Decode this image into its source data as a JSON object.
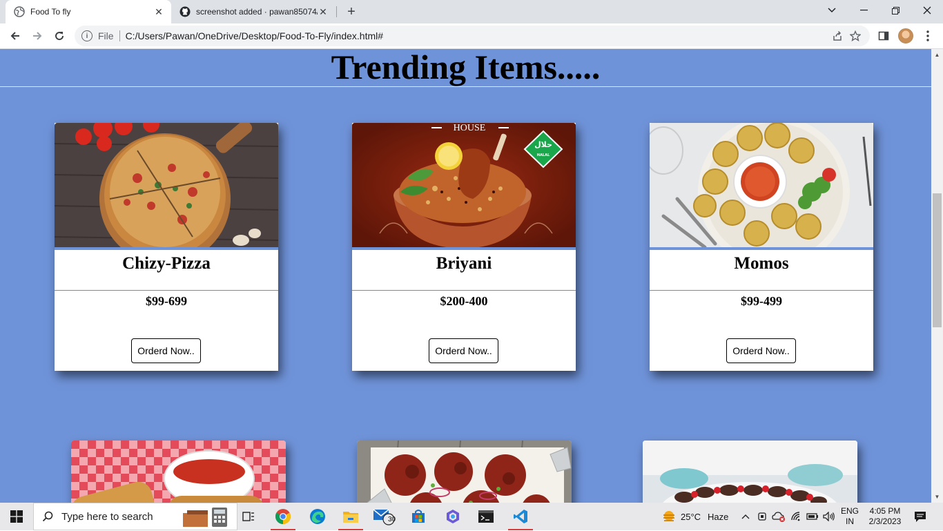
{
  "browser": {
    "tabs": [
      {
        "title": "Food To fly",
        "active": true
      },
      {
        "title": "screenshot added · pawan85074/",
        "active": false
      }
    ],
    "address": {
      "scheme": "File",
      "url": "C:/Users/Pawan/OneDrive/Desktop/Food-To-Fly/index.html#"
    }
  },
  "page": {
    "heading": "Trending Items.....",
    "background_color": "#6f93d9",
    "cards": [
      {
        "name": "Chizy-Pizza",
        "price": "$99-699",
        "button": "Orderd Now.."
      },
      {
        "name": "Briyani",
        "price": "$200-400",
        "button": "Orderd Now.."
      },
      {
        "name": "Momos",
        "price": "$99-499",
        "button": "Orderd Now.."
      }
    ],
    "brand_overlay": {
      "house": "HOUSE",
      "halal": "HALAL"
    }
  },
  "taskbar": {
    "search_placeholder": "Type here to search",
    "mail_badge": "30",
    "weather": {
      "temp": "25°C",
      "condition": "Haze"
    },
    "language": {
      "line1": "ENG",
      "line2": "IN"
    },
    "clock": {
      "time": "4:05 PM",
      "date": "2/3/2023"
    }
  }
}
